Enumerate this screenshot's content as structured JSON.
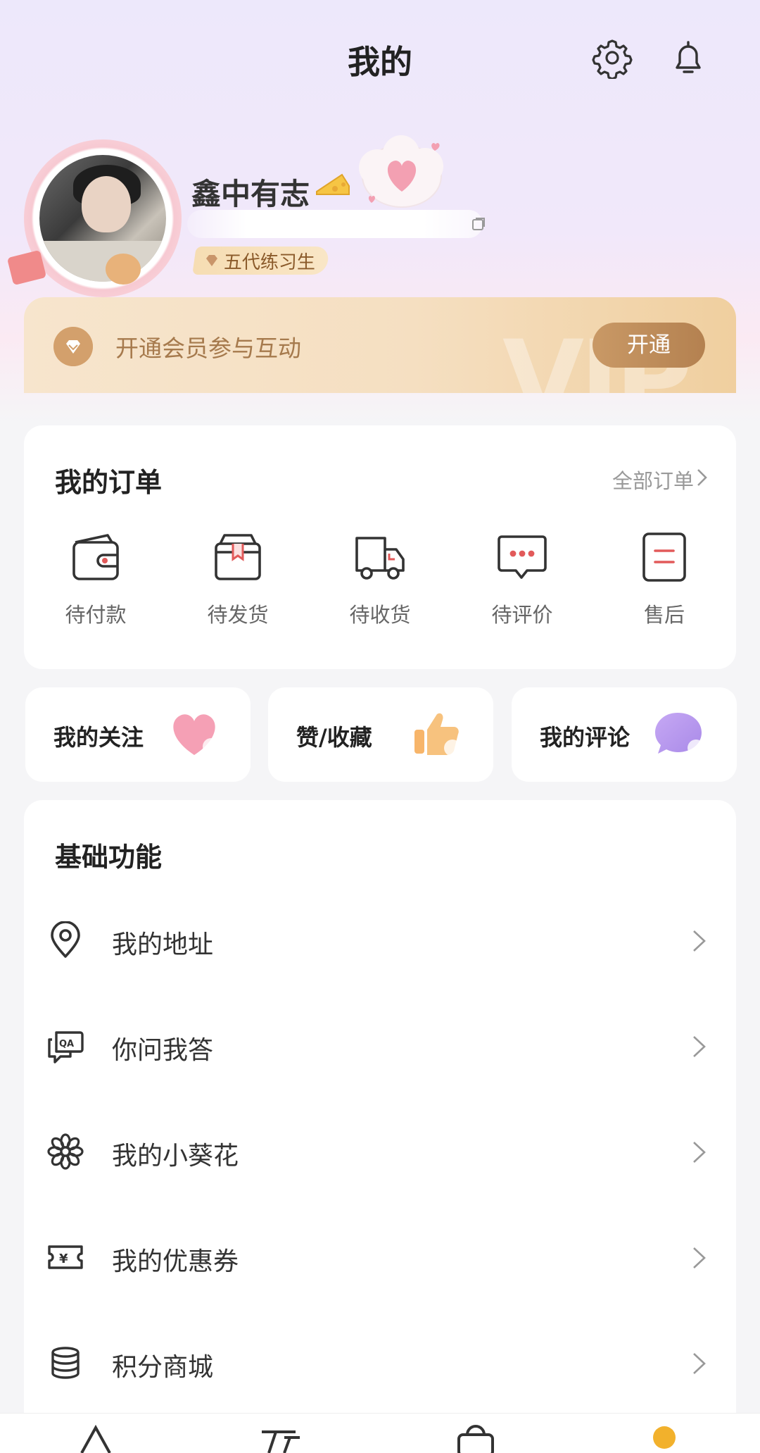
{
  "header": {
    "title": "我的",
    "settings_icon": "gear-icon",
    "notify_icon": "bell-icon"
  },
  "profile": {
    "name": "鑫中有志",
    "level": "五代练习生"
  },
  "vip": {
    "text": "开通会员参与互动",
    "button": "开通",
    "watermark": "VIP"
  },
  "orders": {
    "title": "我的订单",
    "all_label": "全部订单",
    "items": [
      {
        "label": "待付款",
        "icon": "wallet-icon"
      },
      {
        "label": "待发货",
        "icon": "package-icon"
      },
      {
        "label": "待收货",
        "icon": "truck-icon"
      },
      {
        "label": "待评价",
        "icon": "comment-icon"
      },
      {
        "label": "售后",
        "icon": "after-sale-icon"
      }
    ]
  },
  "quick": [
    {
      "label": "我的关注",
      "icon": "heart-icon"
    },
    {
      "label": "赞/收藏",
      "icon": "thumbs-up-icon"
    },
    {
      "label": "我的评论",
      "icon": "chat-bubble-icon"
    }
  ],
  "basic": {
    "title": "基础功能",
    "items": [
      {
        "label": "我的地址",
        "icon": "location-pin-icon"
      },
      {
        "label": "你问我答",
        "icon": "qa-icon"
      },
      {
        "label": "我的小葵花",
        "icon": "flower-icon"
      },
      {
        "label": "我的优惠券",
        "icon": "coupon-icon"
      },
      {
        "label": "积分商城",
        "icon": "coins-stack-icon"
      }
    ]
  },
  "colors": {
    "accent_gold": "#b48150",
    "order_red": "#e25a5a",
    "vip_bg": "#f5dfc1"
  }
}
